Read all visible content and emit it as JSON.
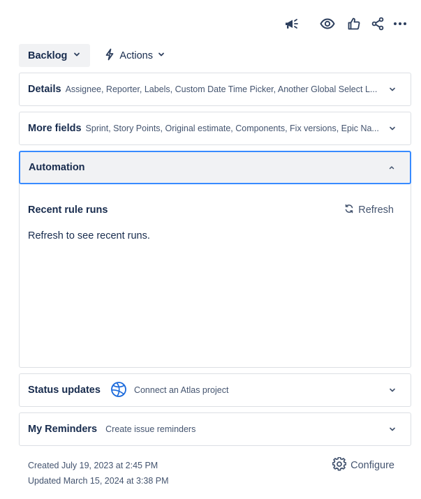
{
  "top_actions": {
    "icons": [
      "megaphone-icon",
      "eye-icon",
      "thumbs-up-icon",
      "share-icon",
      "more-icon"
    ]
  },
  "toolbar": {
    "status_label": "Backlog",
    "actions_label": "Actions"
  },
  "panels": {
    "details": {
      "title": "Details",
      "summary": "Assignee, Reporter, Labels, Custom Date Time Picker, Another Global Select L..."
    },
    "more_fields": {
      "title": "More fields",
      "summary": "Sprint, Story Points, Original estimate, Components, Fix versions, Epic Na..."
    },
    "automation": {
      "title": "Automation",
      "recent_runs_title": "Recent rule runs",
      "refresh_label": "Refresh",
      "empty_text": "Refresh to see recent runs."
    },
    "status_updates": {
      "title": "Status updates",
      "link_label": "Connect an Atlas project"
    },
    "reminders": {
      "title": "My Reminders",
      "summary": "Create issue reminders"
    }
  },
  "footer": {
    "created": "Created July 19, 2023 at 2:45 PM",
    "updated": "Updated March 15, 2024 at 3:38 PM",
    "configure_label": "Configure"
  },
  "colors": {
    "text": "#172b4d",
    "subtle_text": "#44546f",
    "focus_border": "#388bff",
    "panel_border": "#dcdfe4",
    "button_bg": "#f1f2f4",
    "atlas_blue": "#1868db"
  }
}
